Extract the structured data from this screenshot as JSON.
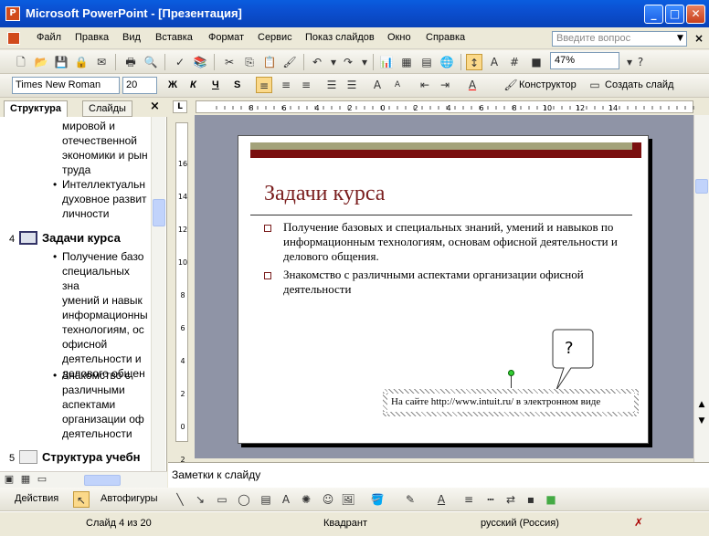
{
  "window": {
    "title": "Microsoft PowerPoint - [Презентация]",
    "app_icon": "powerpoint-icon",
    "buttons": {
      "minimize": "_",
      "maximize": "□",
      "close": "✕"
    }
  },
  "menu": {
    "items": [
      "Файл",
      "Правка",
      "Вид",
      "Вставка",
      "Формат",
      "Сервис",
      "Показ слайдов",
      "Окно",
      "Справка"
    ],
    "help_placeholder": "Введите вопрос",
    "close_glyph": "×"
  },
  "standard_toolbar": {
    "zoom": "47%"
  },
  "format_toolbar": {
    "font": "Times New Roman",
    "size": "20",
    "bold": "Ж",
    "italic": "К",
    "underline": "Ч",
    "shadow": "S",
    "designer": "Конструктор",
    "new_slide": "Создать слайд"
  },
  "left_pane": {
    "tabs": [
      "Структура",
      "Слайды"
    ],
    "close_glyph": "×",
    "outline_lines_top": [
      "мировой и",
      "отечественной",
      "экономики и рын",
      "труда"
    ],
    "bullet_intel": [
      "Интеллектуальн",
      "духовное развит",
      "личности"
    ],
    "slide4": {
      "number": "4",
      "title": "Задачи курса"
    },
    "bullet1": [
      "Получение базо",
      "специальных зна",
      "умений и навык",
      "информационны",
      "технологиям, ос",
      "офисной",
      "деятельности и",
      "делового общен"
    ],
    "bullet2": [
      "Знакомство с",
      "различными",
      "аспектами",
      "организации оф",
      "деятельности"
    ],
    "slide5": {
      "number": "5",
      "title": "Структура учебн"
    }
  },
  "slide": {
    "title": "Задачи курса",
    "bullets": [
      "Получение базовых и специальных знаний, умений и навыков по информационным технологиям, основам офисной деятельности и делового общения.",
      "Знакомство с различными аспектами организации офисной деятельности"
    ],
    "callout": "?",
    "footer_text": "На сайте http://www.intuit.ru/ в электронном виде",
    "colors": {
      "band1": "#a3a27a",
      "band2": "#7a0f0f",
      "title": "#7a1e1e"
    }
  },
  "ruler": {
    "h_labels": [
      "8",
      "6",
      "4",
      "2",
      "0",
      "2",
      "4",
      "6",
      "8",
      "10",
      "12",
      "14"
    ],
    "v_labels": [
      "16",
      "14",
      "12",
      "10",
      "8",
      "6",
      "4",
      "2",
      "0",
      "2"
    ]
  },
  "notes": {
    "placeholder": "Заметки к слайду"
  },
  "drawing_toolbar": {
    "actions": "Действия",
    "autoshapes": "Автофигуры"
  },
  "status": {
    "slide": "Слайд 4 из 20",
    "design": "Квадрант",
    "language": "русский (Россия)"
  }
}
